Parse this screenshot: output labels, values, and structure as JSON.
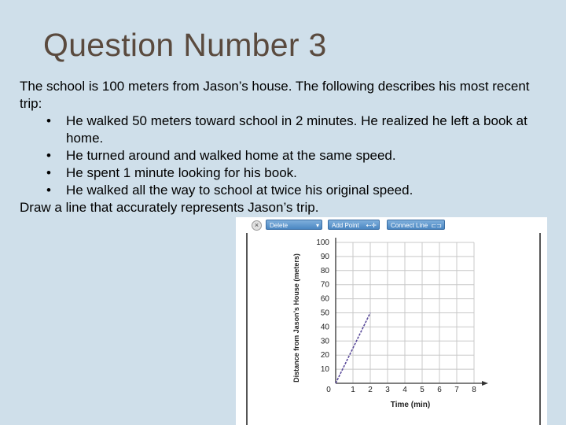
{
  "slide": {
    "title": "Question Number 3",
    "intro": "The school is 100 meters from Jason’s house. The following describes his most recent trip:",
    "bullets": [
      "He walked 50 meters toward school in 2 minutes. He realized he left a book at home.",
      "He turned around and walked home at the same speed.",
      "He spent 1 minute looking for his book.",
      "He walked all the way to school at twice his original speed."
    ],
    "instruction": "Draw a line that accurately represents Jason’s trip."
  },
  "toolbar": {
    "delete_label": "Delete",
    "add_point_label": "Add Point",
    "connect_line_label": "Connect Line"
  },
  "chart_data": {
    "type": "line",
    "xlabel": "Time (min)",
    "ylabel": "Distance from Jason’s House (meters)",
    "x_ticks": [
      "0",
      "1",
      "2",
      "3",
      "4",
      "5",
      "6",
      "7",
      "8"
    ],
    "y_ticks": [
      "10",
      "20",
      "30",
      "40",
      "50",
      "60",
      "70",
      "80",
      "90",
      "100"
    ],
    "xlim": [
      0,
      8
    ],
    "ylim": [
      0,
      100
    ],
    "grid": true,
    "series": [
      {
        "points": [
          [
            0,
            0
          ],
          [
            2,
            50
          ]
        ],
        "color": "#5a4a9a"
      }
    ]
  }
}
